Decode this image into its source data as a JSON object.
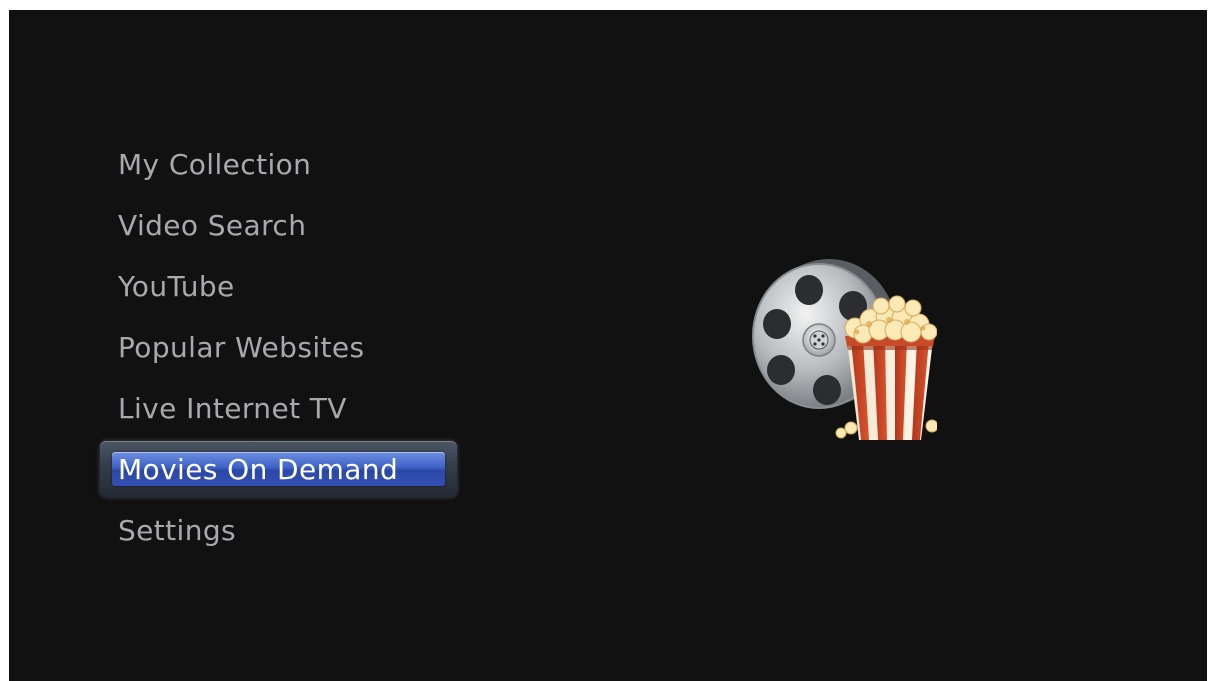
{
  "menu": {
    "items": [
      {
        "label": "My Collection",
        "selected": false
      },
      {
        "label": "Video Search",
        "selected": false
      },
      {
        "label": "YouTube",
        "selected": false
      },
      {
        "label": "Popular Websites",
        "selected": false
      },
      {
        "label": "Live Internet TV",
        "selected": false
      },
      {
        "label": "Movies On Demand",
        "selected": true
      },
      {
        "label": "Settings",
        "selected": false
      }
    ]
  },
  "preview": {
    "icon": "film-reel-popcorn-icon"
  },
  "colors": {
    "background": "#111111",
    "menu_text": "#a9a9ad",
    "selected_text": "#ffffff",
    "highlight_blue": "#3f62c8"
  }
}
